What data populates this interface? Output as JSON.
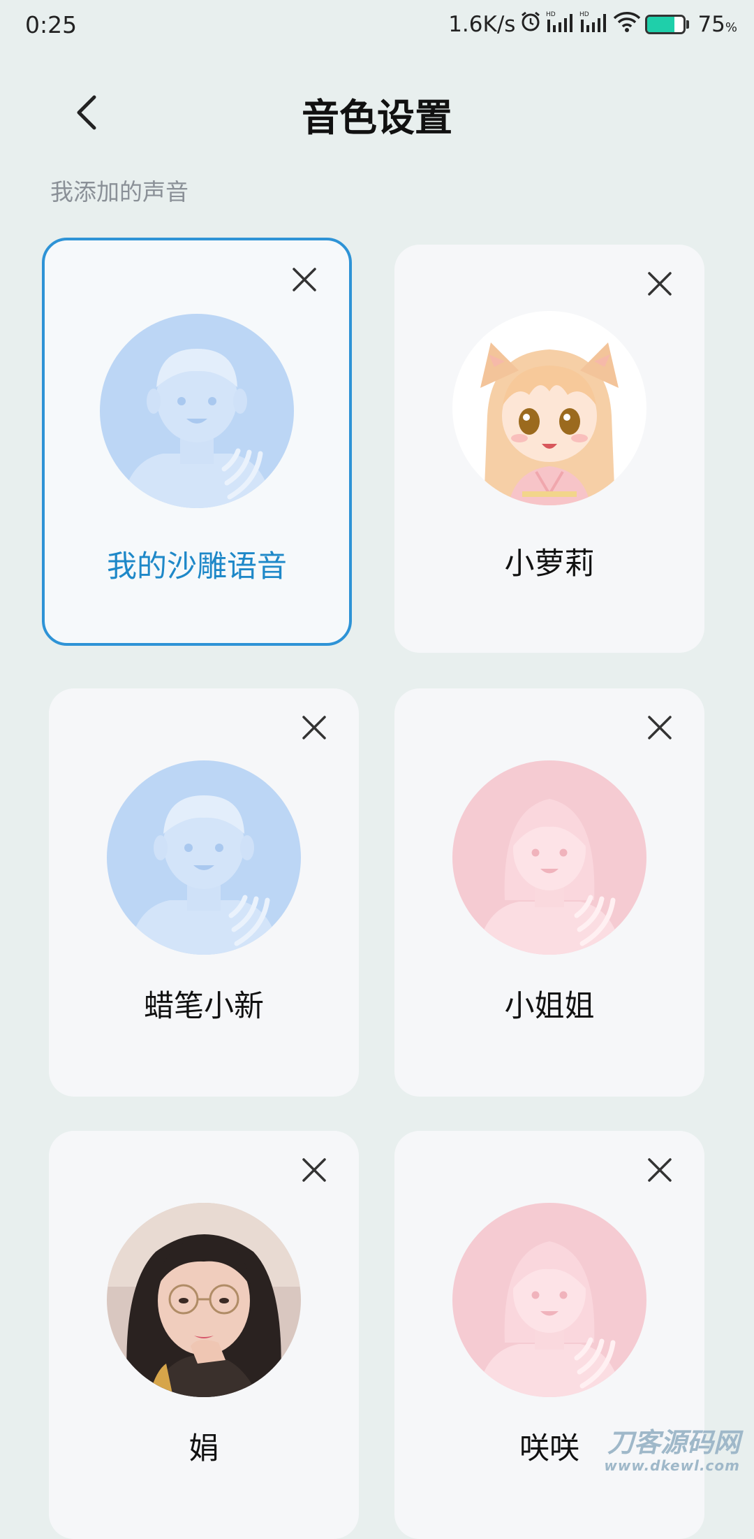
{
  "status_bar": {
    "time": "0:25",
    "net_speed": "1.6K/s",
    "battery_percent": 75,
    "battery_text": "75",
    "battery_unit": "%",
    "icons": [
      "alarm-icon",
      "signal-hd-icon",
      "signal-hd-icon",
      "wifi-icon",
      "battery-icon"
    ]
  },
  "header": {
    "back_icon": "chevron-left-icon",
    "title": "音色设置"
  },
  "section": {
    "label": "我添加的声音"
  },
  "voices": [
    {
      "name": "我的沙雕语音",
      "selected": true,
      "avatar": "male-placeholder"
    },
    {
      "name": "小萝莉",
      "selected": false,
      "avatar": "anime-girl-photo"
    },
    {
      "name": "蜡笔小新",
      "selected": false,
      "avatar": "male-placeholder"
    },
    {
      "name": "小姐姐",
      "selected": false,
      "avatar": "female-placeholder"
    },
    {
      "name": "娟",
      "selected": false,
      "avatar": "woman-photo"
    },
    {
      "name": "咲咲",
      "selected": false,
      "avatar": "female-placeholder"
    }
  ],
  "colors": {
    "accent": "#1e88c8",
    "selected_border": "#2e93d6",
    "male_avatar_bg": "#bcd6f5",
    "female_avatar_bg": "#f5cbd2",
    "battery": "#1fcfaa"
  },
  "watermark": {
    "text": "刀客源码网",
    "url": "www.dkewl.com"
  }
}
